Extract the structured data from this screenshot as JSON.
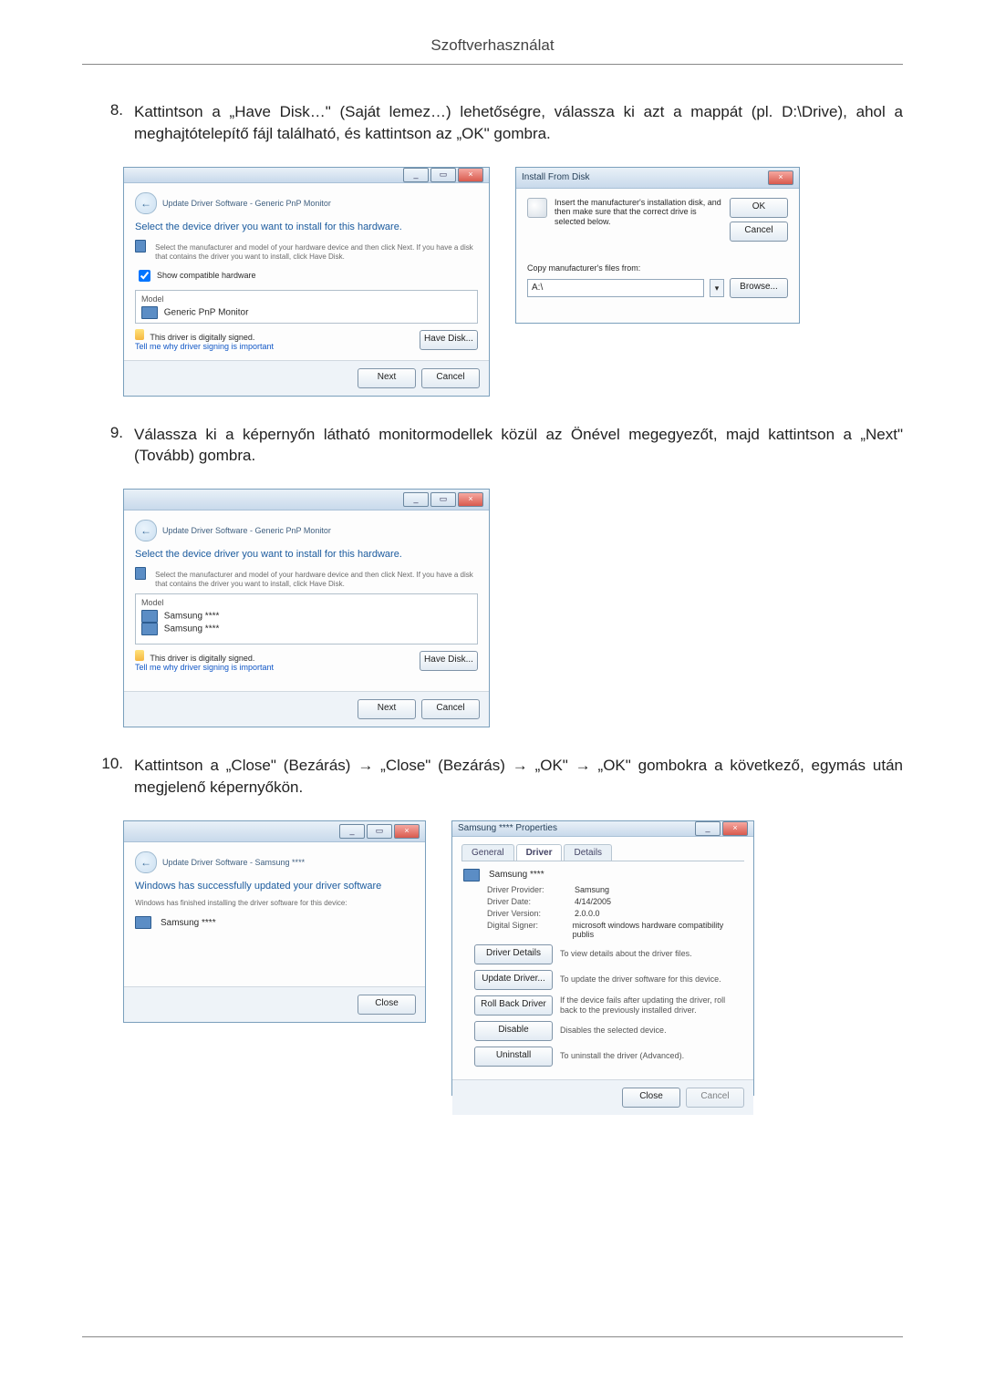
{
  "header": {
    "title": "Szoftverhasználat"
  },
  "steps": {
    "s8": {
      "num": "8.",
      "text": "Kattintson a „Have Disk…\" (Saját lemez…) lehetőségre, válassza ki azt a mappát (pl. D:\\Drive), ahol a meghajtótelepítő fájl található, és kattintson az „OK\" gombra."
    },
    "s9": {
      "num": "9.",
      "text": "Válassza ki a képernyőn látható monitormodellek közül az Önével megegyezőt, majd kattintson a „Next\" (Tovább) gombra."
    },
    "s10": {
      "num": "10.",
      "text": "Kattintson a „Close\" (Bezárás) → „Close\" (Bezárás) → „OK\" → „OK\" gombokra a következő, egymás után megjelenő képernyőkön."
    }
  },
  "common": {
    "winmin": "_",
    "winmax": "▭",
    "winclose": "×"
  },
  "dlgA": {
    "breadcrumb": "Update Driver Software - Generic PnP Monitor",
    "heading": "Select the device driver you want to install for this hardware.",
    "note": "Select the manufacturer and model of your hardware device and then click Next. If you have a disk that contains the driver you want to install, click Have Disk.",
    "chk_compat": "Show compatible hardware",
    "list_label": "Model",
    "list_item": "Generic PnP Monitor",
    "signed": "This driver is digitally signed.",
    "signed_link": "Tell me why driver signing is important",
    "have_disk": "Have Disk...",
    "next": "Next",
    "cancel": "Cancel"
  },
  "dlgB": {
    "title": "Install From Disk",
    "msg": "Insert the manufacturer's installation disk, and then make sure that the correct drive is selected below.",
    "ok": "OK",
    "cancel": "Cancel",
    "copy_label": "Copy manufacturer's files from:",
    "path": "A:\\",
    "browse": "Browse..."
  },
  "dlgC": {
    "breadcrumb": "Update Driver Software - Generic PnP Monitor",
    "heading": "Select the device driver you want to install for this hardware.",
    "note": "Select the manufacturer and model of your hardware device and then click Next. If you have a disk that contains the driver you want to install, click Have Disk.",
    "list_label": "Model",
    "list_item1": "Samsung ****",
    "list_item2": "Samsung ****",
    "signed": "This driver is digitally signed.",
    "signed_link": "Tell me why driver signing is important",
    "have_disk": "Have Disk...",
    "next": "Next",
    "cancel": "Cancel"
  },
  "dlgD": {
    "breadcrumb": "Update Driver Software - Samsung ****",
    "heading": "Windows has successfully updated your driver software",
    "note": "Windows has finished installing the driver software for this device:",
    "device": "Samsung ****",
    "close": "Close"
  },
  "dlgE": {
    "title": "Samsung **** Properties",
    "tab_general": "General",
    "tab_driver": "Driver",
    "tab_details": "Details",
    "device": "Samsung ****",
    "rows": {
      "provider_k": "Driver Provider:",
      "provider_v": "Samsung",
      "date_k": "Driver Date:",
      "date_v": "4/14/2005",
      "version_k": "Driver Version:",
      "version_v": "2.0.0.0",
      "signer_k": "Digital Signer:",
      "signer_v": "microsoft windows hardware compatibility publis"
    },
    "btns": {
      "details": "Driver Details",
      "details_d": "To view details about the driver files.",
      "update": "Update Driver...",
      "update_d": "To update the driver software for this device.",
      "rollback": "Roll Back Driver",
      "rollback_d": "If the device fails after updating the driver, roll back to the previously installed driver.",
      "disable": "Disable",
      "disable_d": "Disables the selected device.",
      "uninstall": "Uninstall",
      "uninstall_d": "To uninstall the driver (Advanced)."
    },
    "close": "Close",
    "cancel": "Cancel"
  }
}
